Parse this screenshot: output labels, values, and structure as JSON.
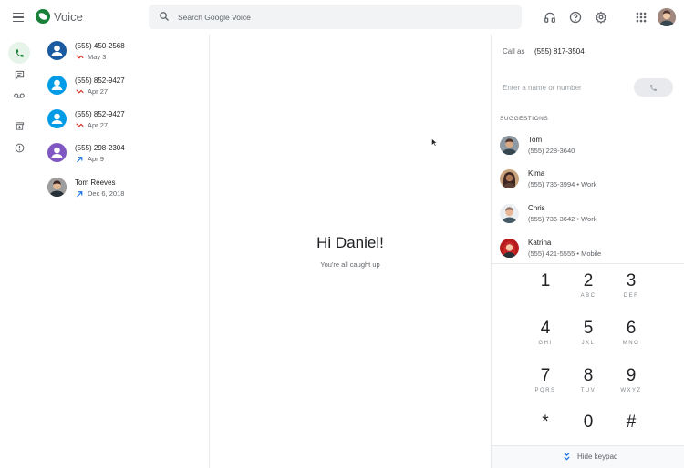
{
  "app": {
    "title": "Voice",
    "brand_color": "#188038"
  },
  "header": {
    "search_placeholder": "Search Google Voice",
    "icons": [
      "menu-icon",
      "search-icon",
      "headset-icon",
      "help-icon",
      "settings-icon",
      "apps-icon"
    ]
  },
  "rail": {
    "items": [
      {
        "name": "calls",
        "icon": "phone-icon",
        "active": true
      },
      {
        "name": "messages",
        "icon": "message-icon",
        "active": false
      },
      {
        "name": "voicemail",
        "icon": "voicemail-icon",
        "active": false
      },
      {
        "name": "archive",
        "icon": "archive-icon",
        "active": false
      },
      {
        "name": "spam",
        "icon": "spam-icon",
        "active": false
      }
    ]
  },
  "conversations": [
    {
      "number": "(555) 450-2568",
      "date": "May 3",
      "status": "missed",
      "avatar_color": "#1a5aa0"
    },
    {
      "number": "(555) 852-9427",
      "date": "Apr 27",
      "status": "missed",
      "avatar_color": "#039be5"
    },
    {
      "number": "(555) 852-9427",
      "date": "Apr 27",
      "status": "missed",
      "avatar_color": "#039be5"
    },
    {
      "number": "(555) 298-2304",
      "date": "Apr 9",
      "status": "outgoing",
      "avatar_color": "#7e57c2"
    },
    {
      "number": "Tom Reeves",
      "date": "Dec 6, 2018",
      "status": "outgoing",
      "avatar_color": "#795548"
    }
  ],
  "main": {
    "greeting": "Hi Daniel!",
    "subtitle": "You're all caught up"
  },
  "dialer": {
    "call_as_label": "Call as",
    "call_as_number": "(555) 817-3504",
    "input_placeholder": "Enter a name or number",
    "suggestions_label": "SUGGESTIONS",
    "suggestions": [
      {
        "name": "Tom",
        "detail": "(555) 228-3640",
        "avatar_color": "#6d4c41"
      },
      {
        "name": "Kima",
        "detail": "(555) 736-3994 • Work",
        "avatar_color": "#8d5a3c"
      },
      {
        "name": "Chris",
        "detail": "(555) 736-3642 • Work",
        "avatar_color": "#a1887f"
      },
      {
        "name": "Katrina",
        "detail": "(555) 421-5555 • Mobile",
        "avatar_color": "#c62828"
      }
    ],
    "keys": [
      {
        "digit": "1",
        "letters": ""
      },
      {
        "digit": "2",
        "letters": "ABC"
      },
      {
        "digit": "3",
        "letters": "DEF"
      },
      {
        "digit": "4",
        "letters": "GHI"
      },
      {
        "digit": "5",
        "letters": "JKL"
      },
      {
        "digit": "6",
        "letters": "MNO"
      },
      {
        "digit": "7",
        "letters": "PQRS"
      },
      {
        "digit": "8",
        "letters": "TUV"
      },
      {
        "digit": "9",
        "letters": "WXYZ"
      },
      {
        "digit": "*",
        "letters": ""
      },
      {
        "digit": "0",
        "letters": ""
      },
      {
        "digit": "#",
        "letters": ""
      }
    ],
    "hide_keypad_label": "Hide keypad"
  }
}
